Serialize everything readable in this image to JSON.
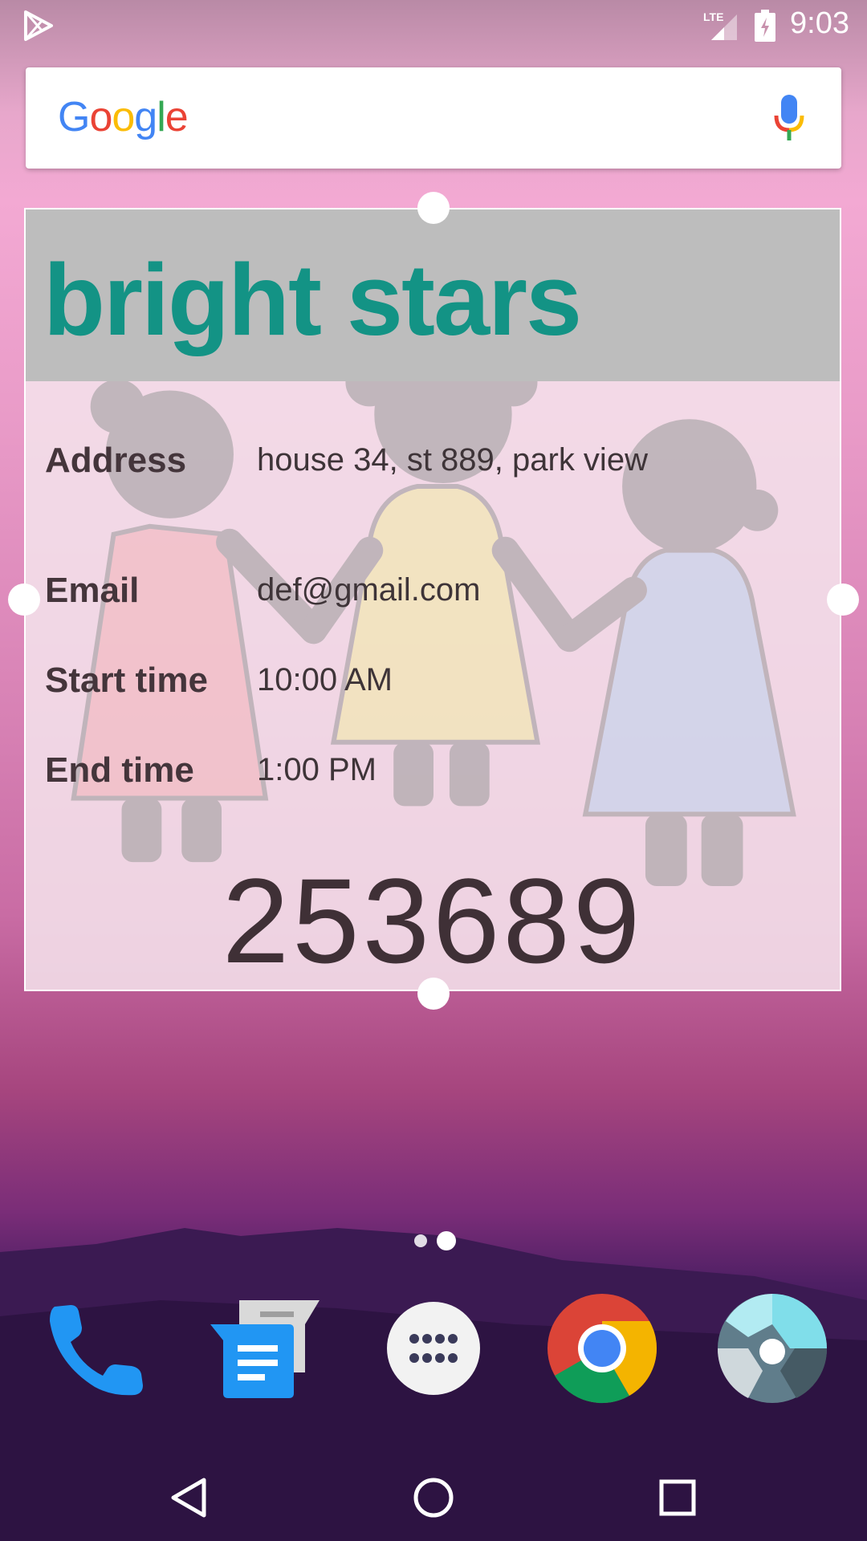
{
  "status_bar": {
    "time": "9:03",
    "network_label": "LTE",
    "icons": [
      "play-store-icon",
      "lte-signal-icon",
      "battery-charging-icon"
    ]
  },
  "search_bar": {
    "logo_text": [
      "G",
      "o",
      "o",
      "g",
      "l",
      "e"
    ],
    "logo_colors": [
      "#4285F4",
      "#EA4335",
      "#FBBC05",
      "#4285F4",
      "#34A853",
      "#EA4335"
    ],
    "mic_icon": "microphone-icon"
  },
  "widget": {
    "title": "bright stars",
    "title_color": "#139385",
    "rows": [
      {
        "label": "Address",
        "value": "house 34, st 889, park view"
      },
      {
        "label": "Email",
        "value": "def@gmail.com"
      },
      {
        "label": "Start time",
        "value": "10:00 AM"
      },
      {
        "label": "End time",
        "value": "1:00 PM"
      }
    ],
    "code": "253689"
  },
  "page_indicator": {
    "pages": 2,
    "current": 2
  },
  "dock": {
    "apps": [
      "phone-icon",
      "messages-icon",
      "app-drawer-icon",
      "chrome-icon",
      "camera-icon"
    ]
  },
  "nav_bar": {
    "buttons": [
      "back-icon",
      "home-icon",
      "recents-icon"
    ]
  }
}
